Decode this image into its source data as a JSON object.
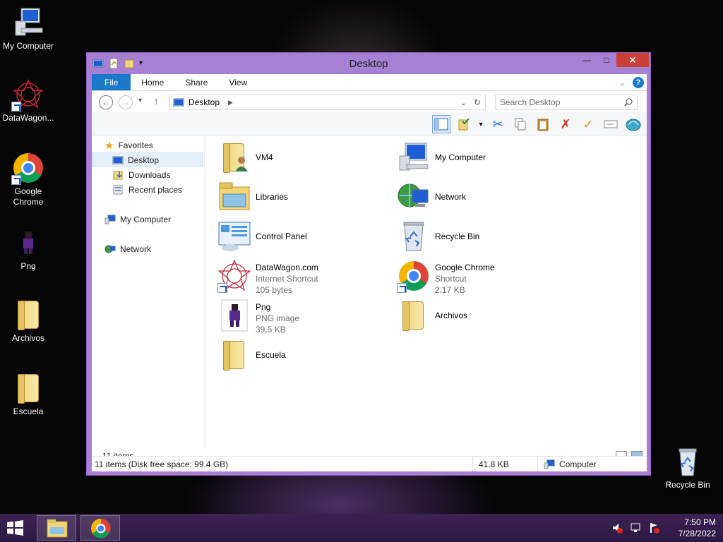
{
  "desktop": {
    "icons": [
      {
        "id": "my-computer",
        "label": "My Computer"
      },
      {
        "id": "datawagon",
        "label": "DataWagon..."
      },
      {
        "id": "google-chrome",
        "label": "Google\nChrome"
      },
      {
        "id": "png",
        "label": "Png"
      },
      {
        "id": "archivos",
        "label": "Archivos"
      },
      {
        "id": "escuela",
        "label": "Escuela"
      },
      {
        "id": "recycle-bin",
        "label": "Recycle Bin"
      }
    ]
  },
  "window": {
    "title": "Desktop",
    "tabs": {
      "file": "File",
      "home": "Home",
      "share": "Share",
      "view": "View"
    },
    "address": {
      "crumb": "Desktop"
    },
    "search": {
      "placeholder": "Search Desktop"
    },
    "nav_pane": {
      "favorites": "Favorites",
      "desktop": "Desktop",
      "downloads": "Downloads",
      "recent_places": "Recent places",
      "my_computer": "My Computer",
      "network": "Network"
    },
    "items": [
      {
        "name": "VM4",
        "sub1": "",
        "sub2": ""
      },
      {
        "name": "My Computer",
        "sub1": "",
        "sub2": ""
      },
      {
        "name": "Libraries",
        "sub1": "",
        "sub2": ""
      },
      {
        "name": "Network",
        "sub1": "",
        "sub2": ""
      },
      {
        "name": "Control Panel",
        "sub1": "",
        "sub2": ""
      },
      {
        "name": "Recycle Bin",
        "sub1": "",
        "sub2": ""
      },
      {
        "name": "DataWagon.com",
        "sub1": "Internet Shortcut",
        "sub2": "105 bytes"
      },
      {
        "name": "Google Chrome",
        "sub1": "Shortcut",
        "sub2": "2.17 KB"
      },
      {
        "name": "Png",
        "sub1": "PNG image",
        "sub2": "39.5 KB"
      },
      {
        "name": "Archivos",
        "sub1": "",
        "sub2": ""
      },
      {
        "name": "Escuela",
        "sub1": "",
        "sub2": ""
      }
    ],
    "item_count": "11 items",
    "status": {
      "summary": "11 items (Disk free space: 99.4 GB)",
      "size": "41.8 KB",
      "location": "Computer"
    }
  },
  "taskbar": {
    "time": "7:50 PM",
    "date": "7/28/2022"
  },
  "colors": {
    "window_frame": "#a780d6",
    "file_tab": "#1979ca",
    "taskbar": "#3b2254",
    "close_button": "#c9403a"
  }
}
